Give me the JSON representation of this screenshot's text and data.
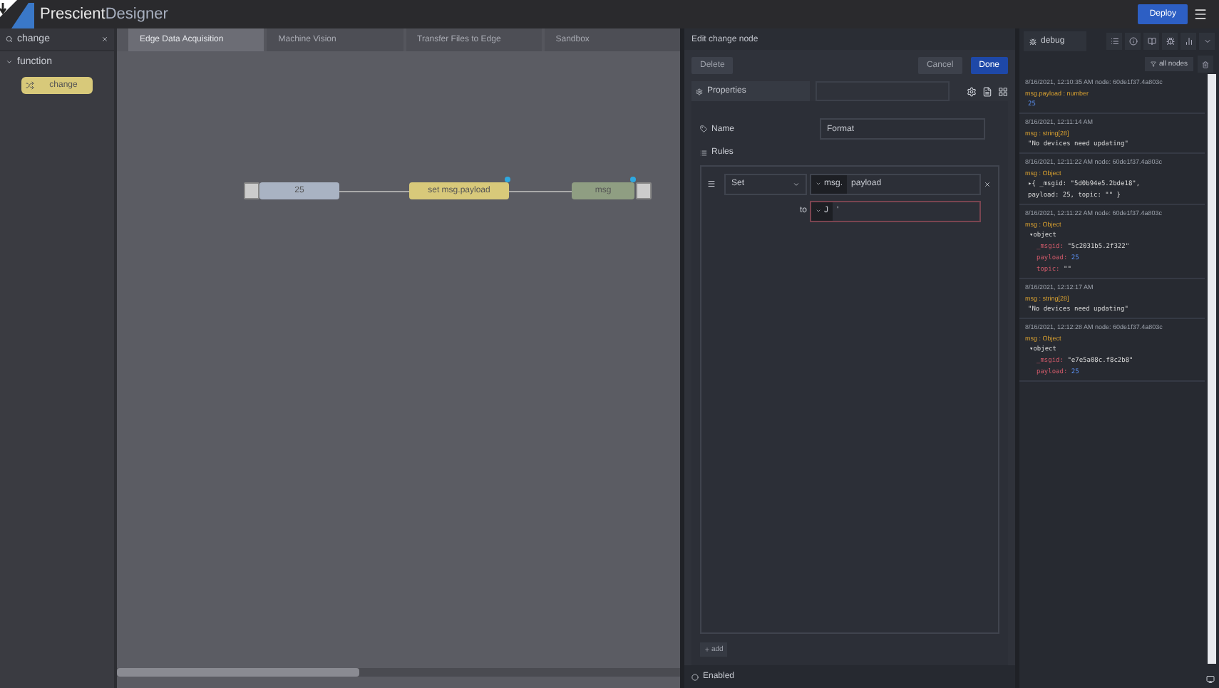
{
  "header": {
    "title_part1": "Prescient",
    "title_part2": "Designer",
    "deploy": "Deploy"
  },
  "palette": {
    "search": "change",
    "category": "function",
    "category_expanded": true,
    "nodes": [
      {
        "label": "change",
        "kind": "change"
      }
    ]
  },
  "workspace": {
    "tabs": [
      {
        "label": "Edge Data Acquisition",
        "selected": true
      },
      {
        "label": "Machine Vision",
        "selected": false
      },
      {
        "label": "Transfer Files to Edge",
        "selected": false
      },
      {
        "label": "Sandbox",
        "selected": false
      }
    ],
    "nodes": [
      {
        "label": "25",
        "kind": "inject",
        "changed": false
      },
      {
        "label": "set msg.payload",
        "kind": "change",
        "changed": true
      },
      {
        "label": "msg",
        "kind": "debug",
        "changed": true
      }
    ]
  },
  "editor": {
    "title": "Edit change node",
    "delete": "Delete",
    "cancel": "Cancel",
    "done": "Done",
    "tab": "Properties",
    "name_label": "Name",
    "name_value": "Format",
    "rules_label": "Rules",
    "rules": [
      {
        "action": "Set",
        "target_type": "msg.",
        "target": "payload",
        "to": "to",
        "value_type": "J",
        "value": "'"
      }
    ],
    "add": "add",
    "enabled_label": "Enabled"
  },
  "debug": {
    "tab": "debug",
    "filter": "all nodes",
    "messages": [
      {
        "meta": "8/16/2021, 12:10:35 AM   node: 60de1f37.4a803c",
        "topic": "msg.payload : number",
        "lines": [
          {
            "kind": "number",
            "text": "25"
          }
        ]
      },
      {
        "meta": "8/16/2021, 12:11:14 AM",
        "topic": "msg : string[28]",
        "lines": [
          {
            "kind": "string",
            "text": "\"No devices need updating\""
          }
        ]
      },
      {
        "meta": "8/16/2021, 12:11:22 AM   node: 60de1f37.4a803c",
        "topic": "msg : Object",
        "lines": [
          {
            "kind": "inline",
            "text": "▸{ _msgid: \"5d0b94e5.2bde18\","
          },
          {
            "kind": "inline",
            "text": "payload: 25, topic: \"\" }"
          }
        ]
      },
      {
        "meta": "8/16/2021, 12:11:22 AM   node: 60de1f37.4a803c",
        "topic": "msg : Object",
        "lines": [
          {
            "kind": "heading",
            "text": "▾object"
          },
          {
            "kind": "prop",
            "key": "_msgid:",
            "text": "\"5c2031b5.2f322\""
          },
          {
            "kind": "prop",
            "key": "payload:",
            "text": "25",
            "number": true
          },
          {
            "kind": "prop",
            "key": "topic:",
            "text": "\"\""
          }
        ]
      },
      {
        "meta": "8/16/2021, 12:12:17 AM",
        "topic": "msg : string[28]",
        "lines": [
          {
            "kind": "string",
            "text": "\"No devices need updating\""
          }
        ]
      },
      {
        "meta": "8/16/2021, 12:12:28 AM   node: 60de1f37.4a803c",
        "topic": "msg : Object",
        "lines": [
          {
            "kind": "heading",
            "text": "▾object"
          },
          {
            "kind": "prop",
            "key": "_msgid:",
            "text": "\"e7e5a08c.f8c2b8\""
          },
          {
            "kind": "prop",
            "key": "payload:",
            "text": "25",
            "number": true
          }
        ]
      }
    ]
  }
}
